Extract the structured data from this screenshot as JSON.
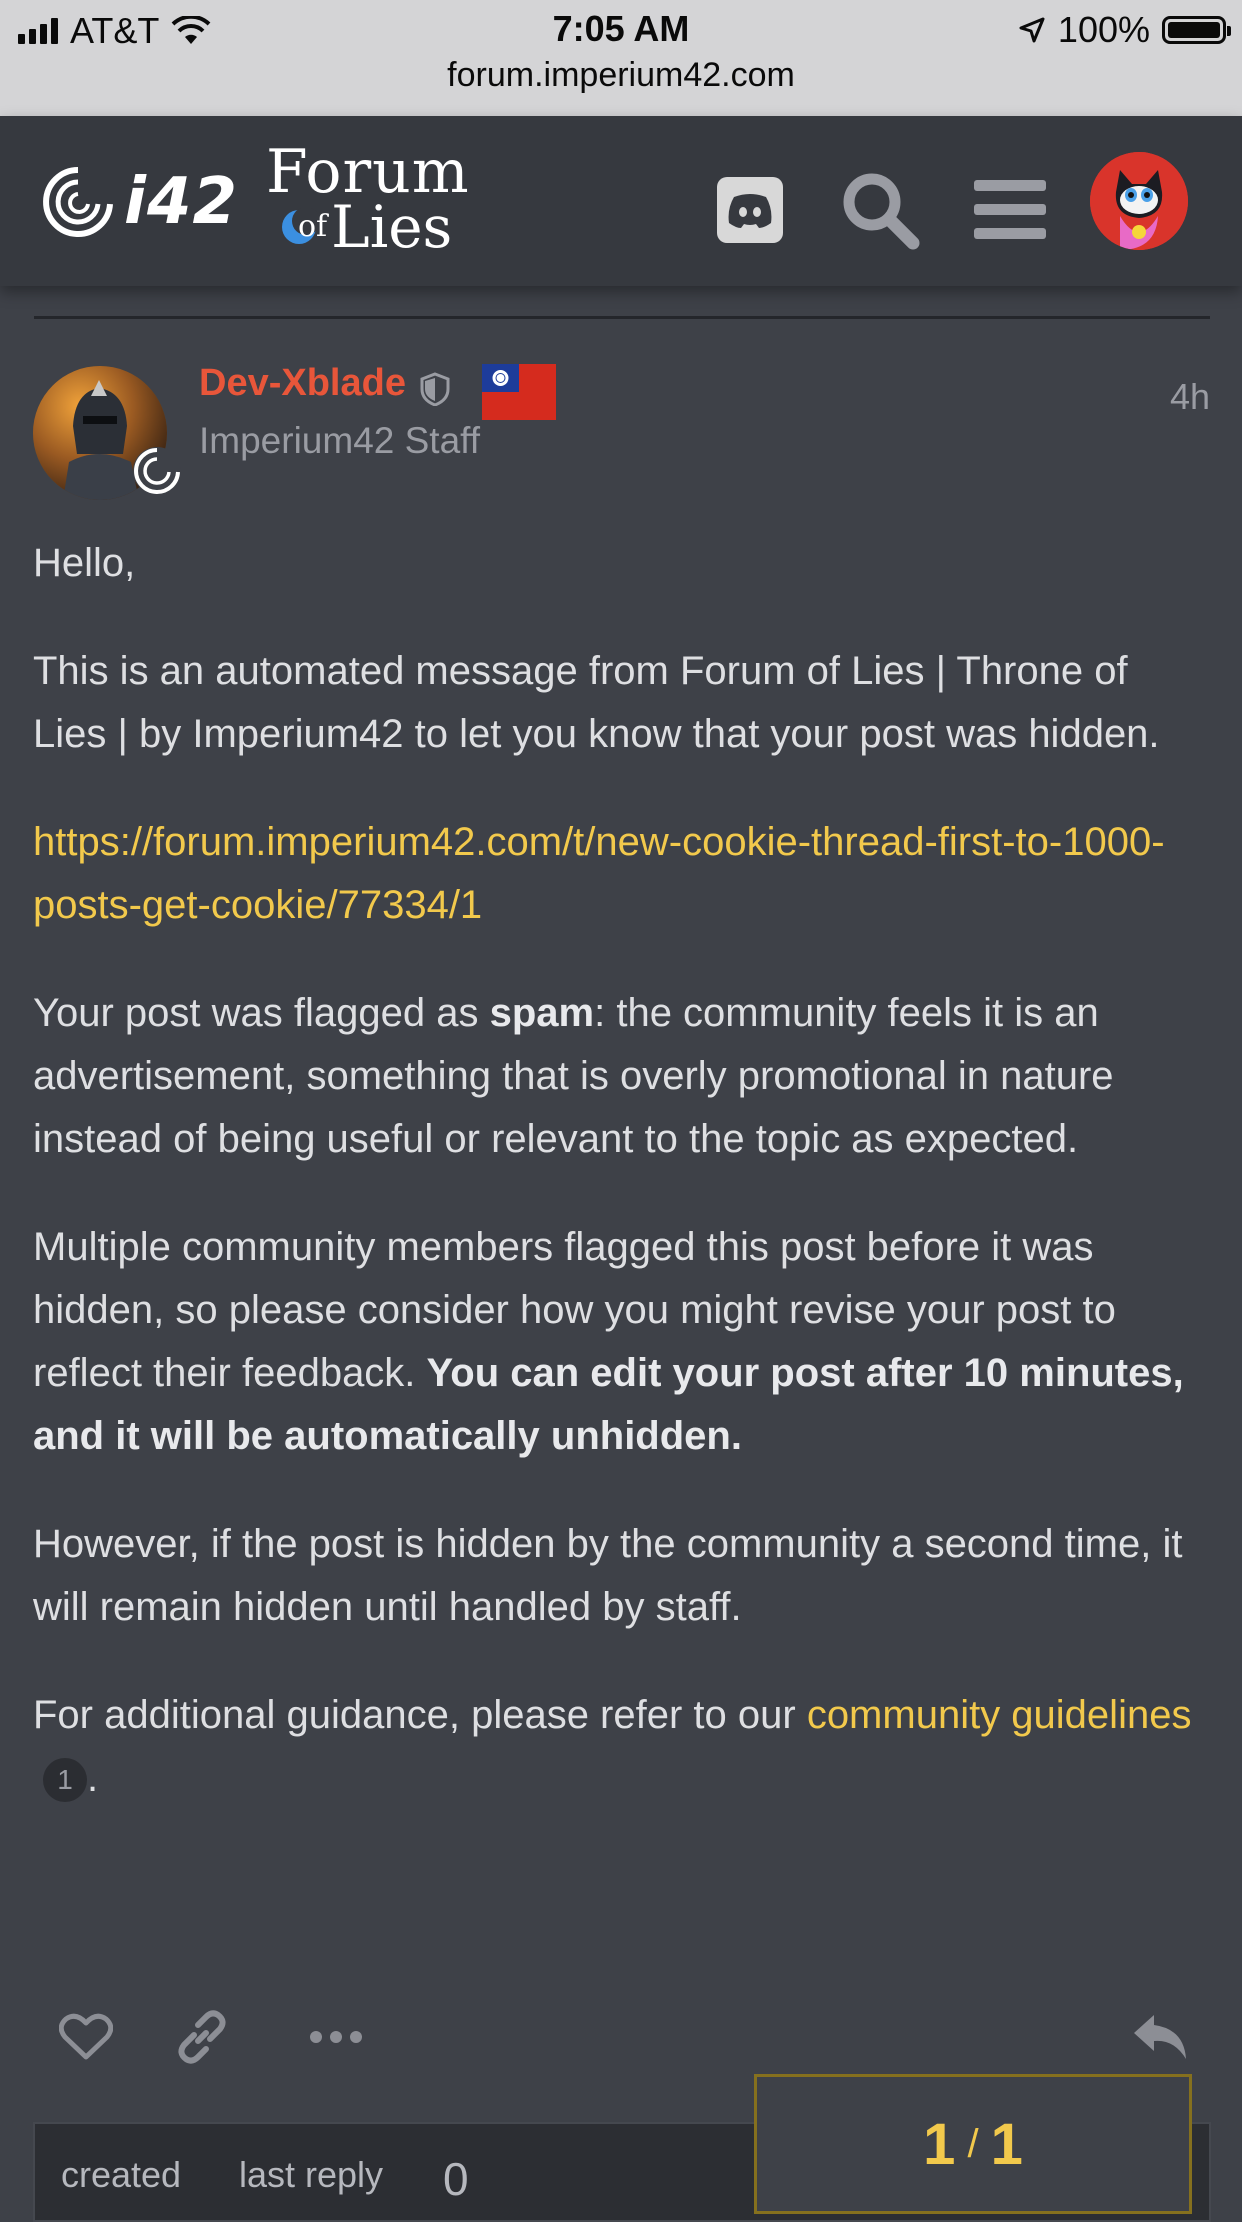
{
  "status_bar": {
    "carrier": "AT&T",
    "time": "7:05 AM",
    "battery": "100%",
    "url": "forum.imperium42.com"
  },
  "header": {
    "logo_text": "i42",
    "forum_logo_line1": "Forum",
    "forum_logo_of": "of",
    "forum_logo_line2": "Lies",
    "icons": [
      "discord-icon",
      "search-icon",
      "hamburger-menu-icon",
      "user-avatar"
    ]
  },
  "post": {
    "username": "Dev-Xblade",
    "user_title": "Imperium42 Staff",
    "age": "4h",
    "greeting": "Hello,",
    "intro": "This is an automated message from Forum of Lies | Throne of Lies | by Imperium42 to let you know that your post was hidden.",
    "post_link": "https://forum.imperium42.com/t/new-cookie-thread-first-to-1000-posts-get-cookie/77334/1",
    "flag_text_before": "Your post was flagged as ",
    "flag_reason": "spam",
    "flag_text_after": ": the community feels it is an advertisement, something that is overly promotional in nature instead of being useful or relevant to the topic as expected.",
    "multi_text": "Multiple community members flagged this post before it was hidden, so please consider how you might revise your post to reflect their feedback. ",
    "multi_bold": "You can edit your post after 10 minutes, and it will be automatically unhidden.",
    "however_text": "However, if the post is hidden by the community a second time, it will remain hidden until handled by staff.",
    "guidance_text": "For additional guidance, please refer to our ",
    "guidance_link": "community guidelines",
    "guidance_link_count": "1",
    "guidance_end": "."
  },
  "topic_map": {
    "created_label": "created",
    "last_reply_label": "last reply",
    "replies_count": "0"
  },
  "progress": {
    "current": "1",
    "separator": "/",
    "total": "1"
  },
  "colors": {
    "background": "#3e4148",
    "header": "#36393f",
    "accent_link": "#f2c94c",
    "staff_username": "#e8563a"
  }
}
